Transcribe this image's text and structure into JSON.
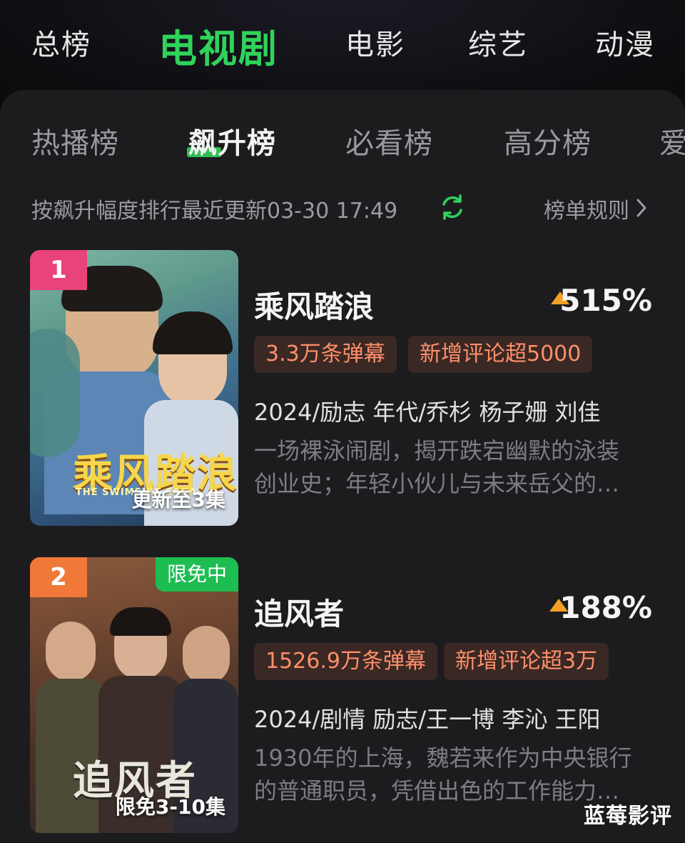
{
  "top_tabs": [
    "总榜",
    "电视剧",
    "电影",
    "综艺",
    "动漫"
  ],
  "sub_tabs": [
    "热播榜",
    "飙升榜",
    "必看榜",
    "高分榜",
    "爱"
  ],
  "info": {
    "text": "按飙升幅度排行最近更新03-30 17:49",
    "rules": "榜单规则"
  },
  "items": [
    {
      "rank": "1",
      "title": "乘风踏浪",
      "change": "515%",
      "tags": [
        "3.3万条弹幕",
        "新增评论超5000"
      ],
      "meta": "2024/励志 年代/乔杉 杨子姗 刘佳",
      "desc": [
        "一场裸泳闹剧，揭开跌宕幽默的泳装",
        "创业史；年轻小伙儿与未来岳父的…"
      ],
      "poster_title": "乘风踏浪",
      "poster_sub": "THE SWIMSUIT SAGA",
      "poster_ep": "更新至3集",
      "badge": ""
    },
    {
      "rank": "2",
      "title": "追风者",
      "change": "188%",
      "tags": [
        "1526.9万条弹幕",
        "新增评论超3万"
      ],
      "meta": "2024/剧情 励志/王一博 李沁 王阳",
      "desc": [
        "1930年的上海，魏若来作为中央银行",
        "的普通职员，凭借出色的工作能力…"
      ],
      "poster_title": "追风者",
      "poster_ep": "限免3-10集",
      "badge": "限免中"
    }
  ],
  "watermark": "蓝莓影评",
  "colors": {
    "accent": "#2fd35a",
    "up": "#f5a024",
    "tag_text": "#ff8f6a"
  },
  "icons": [
    "refresh-icon",
    "chevron-right-icon",
    "trend-up-icon"
  ]
}
